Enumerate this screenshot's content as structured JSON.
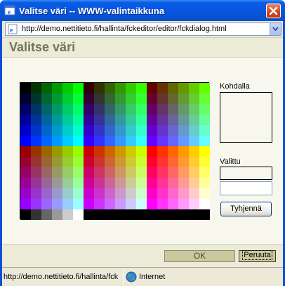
{
  "window": {
    "title": "Valitse väri -- WWW-valintaikkuna"
  },
  "address": {
    "url": "http://demo.nettitieto.fi/hallinta/fckeditor/editor/fckdialog.html"
  },
  "dialog": {
    "title": "Valitse väri",
    "highlight_label": "Kohdalla",
    "selected_label": "Valittu",
    "selected_value": "",
    "clear_label": "Tyhjennä",
    "ok_label": "OK",
    "cancel_label": "Peruuta"
  },
  "status": {
    "url": "http://demo.nettitieto.fi/hallinta/fck",
    "zone": "Internet"
  },
  "colors": {
    "titlebar": "#0a54d9",
    "dialog_bg": "#f7f7ee",
    "header_text": "#737357",
    "button_bg": "#c9c89e"
  },
  "icons": {
    "title": "ie-page-icon",
    "close": "close-x-icon",
    "address": "ie-page-icon",
    "dropdown": "chevron-down-icon",
    "zone": "globe-icon"
  }
}
